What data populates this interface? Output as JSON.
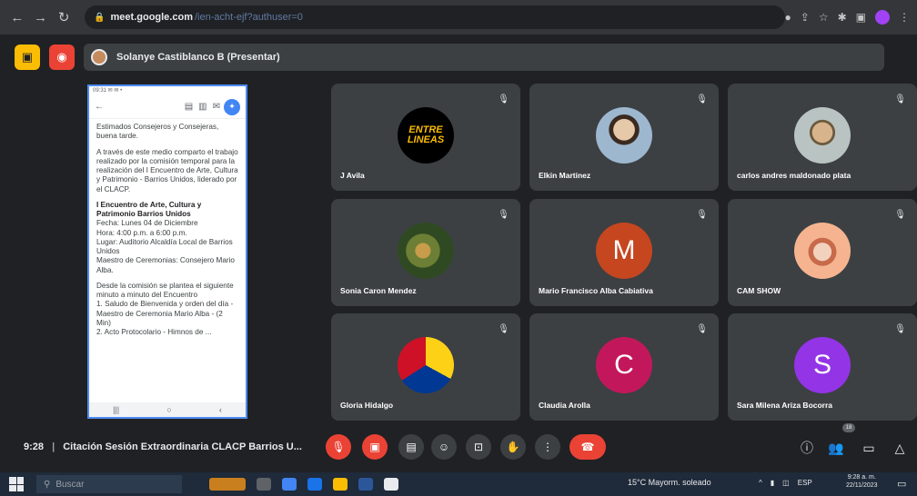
{
  "browser": {
    "url_host": "meet.google.com",
    "url_path": "/ien-acht-ejf?authuser=0"
  },
  "presenter": {
    "label": "Solanye Castiblanco B (Presentar)"
  },
  "document": {
    "status": "09:31  ✉ ✉  •",
    "paragraphs": [
      "Estimados Consejeros y Consejeras, buena tarde.",
      "A través de este medio comparto el trabajo realizado por la comisión temporal para la realización del I Encuentro de Arte, Cultura y Patrimonio - Barrios Unidos, liderado por el CLACP.",
      "I Encuentro de Arte, Cultura y Patrimonio Barrios Unidos",
      "Fecha: Lunes 04 de Diciembre\nHora: 4:00 p.m. a 6:00 p.m.\nLugar: Auditorio Alcaldía Local de Barrios Unidos\nMaestro de Ceremonias: Consejero Mario Alba.",
      "Desde la comisión se plantea el siguiente minuto a minuto del Encuentro\n1. Saludo de Bienvenida y orden del día - Maestro de Ceremonia Mario Alba - (2 Min)\n2. Acto Protocolario - Himnos de ..."
    ]
  },
  "participants": [
    {
      "name": "J Avila",
      "kind": "logo",
      "logo_text": "ENTRE LINEAS"
    },
    {
      "name": "Elkin Martinez",
      "kind": "photo"
    },
    {
      "name": "carlos andres maldonado plata",
      "kind": "photo"
    },
    {
      "name": "Sonia Caron Mendez",
      "kind": "photo"
    },
    {
      "name": "Mario Francisco Alba Cabiativa",
      "kind": "letter",
      "letter": "M",
      "color": "#c5461f"
    },
    {
      "name": "CAM SHOW",
      "kind": "photo"
    },
    {
      "name": "Gloria Hidalgo",
      "kind": "photo"
    },
    {
      "name": "Claudia Arolla",
      "kind": "letter",
      "letter": "C",
      "color": "#c2185b"
    },
    {
      "name": "Sara Milena Ariza Bocorra",
      "kind": "letter",
      "letter": "S",
      "color": "#9334e6"
    }
  ],
  "meeting": {
    "time": "9:28",
    "title": "Citación Sesión Extraordinaria CLACP Barrios U...",
    "participant_count": "18"
  },
  "taskbar": {
    "search_placeholder": "Buscar",
    "weather": "15°C  Mayorm. soleado",
    "lang": "ESP",
    "time": "9:28 a. m.",
    "date": "22/11/2023"
  },
  "icons": {
    "mic_off": "mic-off-icon",
    "end_call": "end-call-icon",
    "people": "people-icon",
    "chat": "chat-icon",
    "activities": "activities-icon"
  }
}
